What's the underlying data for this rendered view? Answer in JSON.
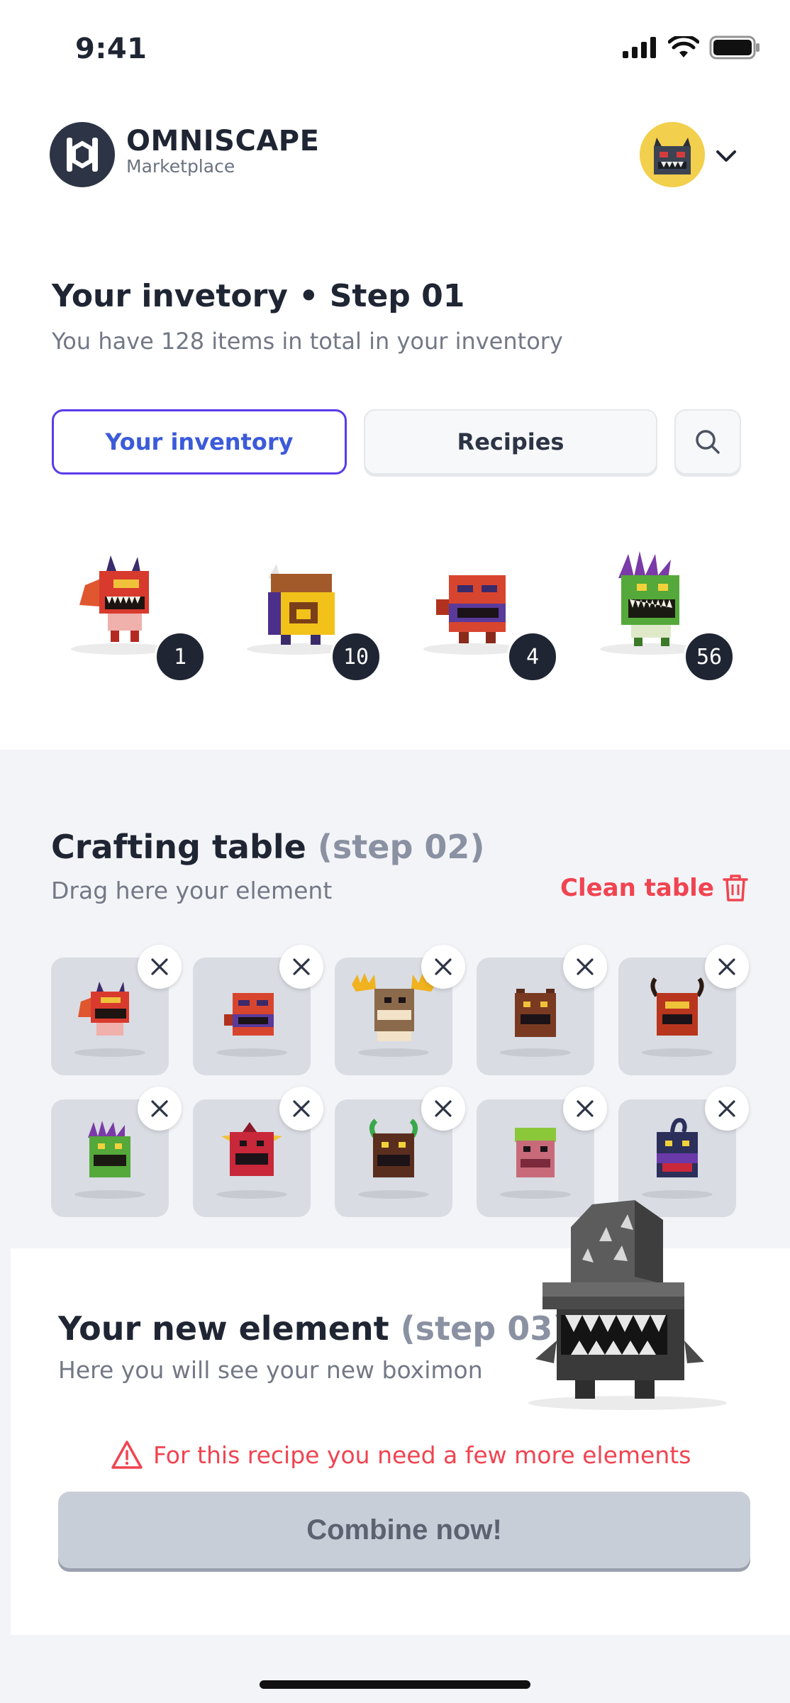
{
  "status_bar": {
    "time": "9:41"
  },
  "header": {
    "brand_name": "OMNISCAPE",
    "brand_sub": "Marketplace"
  },
  "inventory": {
    "title": "Your invetory • Step 01",
    "subtitle": "You have 128 items in total in your inventory",
    "tabs": [
      {
        "label": "Your inventory",
        "active": true
      },
      {
        "label": "Recipies",
        "active": false
      }
    ],
    "items": [
      {
        "name": "red-horned-boximon",
        "quantity": "1"
      },
      {
        "name": "chest-boximon",
        "quantity": "10"
      },
      {
        "name": "red-purple-boximon",
        "quantity": "4"
      },
      {
        "name": "green-spiky-boximon",
        "quantity": "56"
      }
    ]
  },
  "crafting": {
    "title": "Crafting table",
    "title_step": "(step 02)",
    "subtitle": "Drag here your element",
    "clean_label": "Clean table",
    "slots": [
      "red-horned",
      "red-purple",
      "moose",
      "brown-bear",
      "red-bull",
      "green-spiky",
      "red-yellow-horn",
      "brown-green-horn",
      "pink-green",
      "navy-purple"
    ]
  },
  "result": {
    "title": "Your new element",
    "title_step": "(step 03)",
    "subtitle": "Here you will see your new boximon",
    "warning": "For this recipe you need a few more elements",
    "button": "Combine now!"
  },
  "colors": {
    "accent": "#5a3bea",
    "danger": "#f04451",
    "dark": "#1f2533"
  }
}
